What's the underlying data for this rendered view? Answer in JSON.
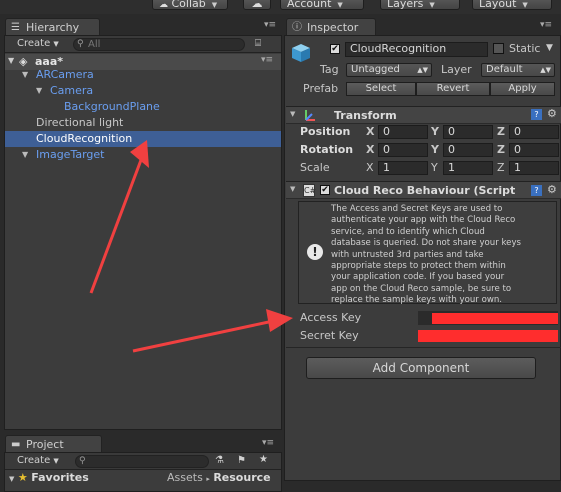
{
  "toolbar": {
    "collab_label": "Collab",
    "account_label": "Account",
    "layers_label": "Layers",
    "layout_label": "Layout"
  },
  "hierarchy": {
    "tab_label": "Hierarchy",
    "create_label": "Create",
    "search_placeholder": "All",
    "scene_name": "aaa*",
    "items": [
      {
        "label": "ARCamera",
        "depth": 1,
        "prefab": true,
        "selected": false
      },
      {
        "label": "Camera",
        "depth": 2,
        "prefab": true,
        "selected": false
      },
      {
        "label": "BackgroundPlane",
        "depth": 3,
        "prefab": true,
        "selected": false
      },
      {
        "label": "Directional light",
        "depth": 1,
        "prefab": false,
        "selected": false
      },
      {
        "label": "CloudRecognition",
        "depth": 1,
        "prefab": false,
        "selected": true
      },
      {
        "label": "ImageTarget",
        "depth": 1,
        "prefab": true,
        "selected": false
      }
    ]
  },
  "project": {
    "tab_label": "Project",
    "create_label": "Create",
    "favorites_label": "Favorites",
    "breadcrumb": [
      "Assets",
      "Resource"
    ]
  },
  "inspector": {
    "tab_label": "Inspector",
    "object_name": "CloudRecognition",
    "active": true,
    "static_label": "Static",
    "tag_label": "Tag",
    "tag_value": "Untagged",
    "layer_label": "Layer",
    "layer_value": "Default",
    "prefab_label": "Prefab",
    "prefab_buttons": [
      "Select",
      "Revert",
      "Apply"
    ],
    "transform": {
      "title": "Transform",
      "position_label": "Position",
      "rotation_label": "Rotation",
      "scale_label": "Scale",
      "position": [
        "0",
        "0",
        "0"
      ],
      "rotation": [
        "0",
        "0",
        "0"
      ],
      "scale": [
        "1",
        "1",
        "1"
      ],
      "axes": [
        "X",
        "Y",
        "Z"
      ]
    },
    "component": {
      "title": "Cloud Reco Behaviour (Script",
      "help_text": "The Access and Secret Keys are used to\nauthenticate your app with the Cloud Reco\nservice, and to identify which Cloud\ndatabase is queried. Do not share your keys\nwith untrusted 3rd parties and take\nappropriate steps to protect them within\nyour application code. If you based your\napp on the Cloud Reco sample, be sure to\nreplace the sample keys with your own.",
      "access_key_label": "Access Key",
      "secret_key_label": "Secret Key"
    },
    "add_component_label": "Add Component"
  },
  "annotations": {
    "arrow_color": "#f04040",
    "redaction_color": "#ff2d2d"
  }
}
